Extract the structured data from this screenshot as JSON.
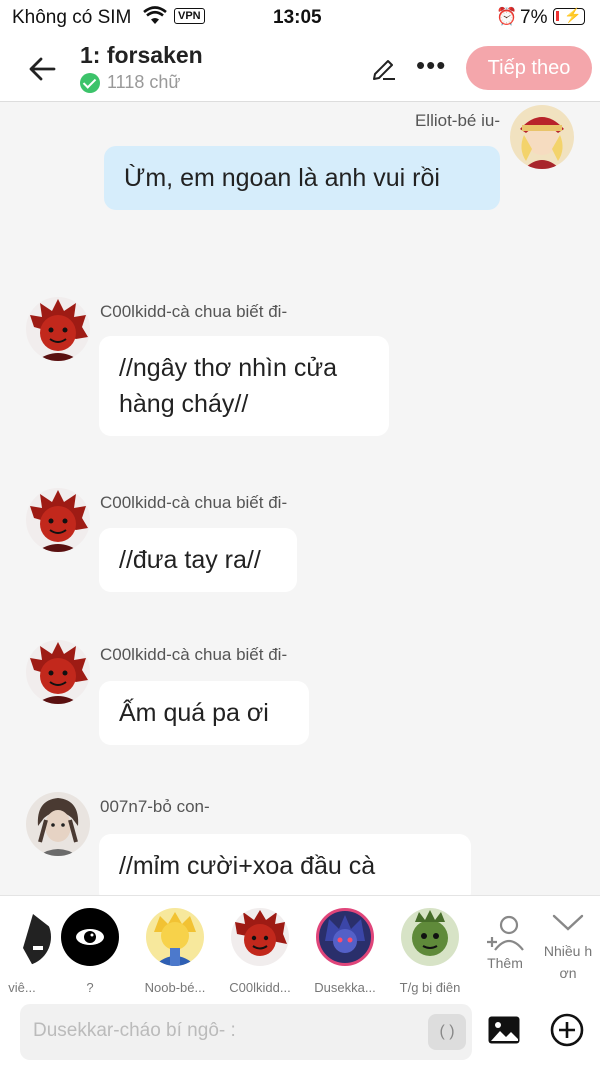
{
  "status": {
    "carrier": "Không có SIM",
    "vpn": "VPN",
    "time": "13:05",
    "battery": "7%"
  },
  "header": {
    "title": "1: forsaken",
    "word_count": "1118 chữ",
    "next_label": "Tiếp theo"
  },
  "messages": [
    {
      "sender": "Elliot-bé iu-",
      "text": "Ừm, em ngoan là anh vui rồi",
      "side": "right"
    },
    {
      "sender": "C00lkidd-cà chua biết đi-",
      "text": "//ngây thơ nhìn cửa hàng cháy//",
      "side": "left"
    },
    {
      "sender": "C00lkidd-cà chua biết đi-",
      "text": "//đưa tay ra//",
      "side": "left"
    },
    {
      "sender": "C00lkidd-cà chua biết đi-",
      "text": "Ấm quá pa ơi",
      "side": "left"
    },
    {
      "sender": "007n7-bỏ con-",
      "text": "//mỉm cười+xoa đầu cà",
      "side": "left"
    }
  ],
  "characters": [
    {
      "label": "viê..."
    },
    {
      "label": "?"
    },
    {
      "label": "Noob-bé..."
    },
    {
      "label": "C00lkidd..."
    },
    {
      "label": "Dusekka..."
    },
    {
      "label": "T/g bị điên"
    }
  ],
  "actions": {
    "add_label": "Thêm",
    "expand_label": "Nhiều h\nơn"
  },
  "composer": {
    "placeholder": "Dusekkar-cháo bí ngô- :",
    "paren_label": "( )"
  },
  "colors": {
    "accent": "#f4a6ab",
    "my_bubble": "#d6edfb",
    "verified": "#3cc36a"
  }
}
